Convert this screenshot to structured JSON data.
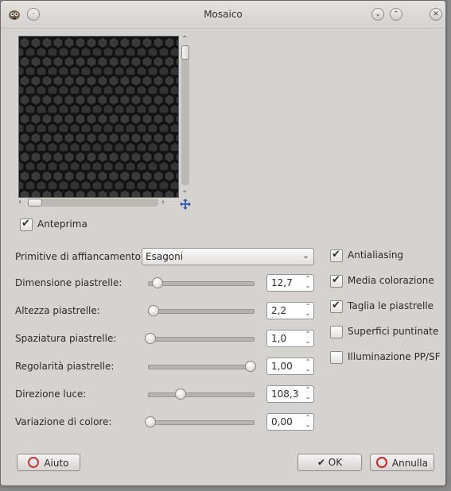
{
  "window": {
    "title": "Mosaico"
  },
  "preview": {
    "checkbox_label": "Anteprima",
    "checked": true
  },
  "primitive": {
    "label": "Primitive di affiancamento:",
    "value": "Esagoni"
  },
  "sliders": [
    {
      "label": "Dimensione piastrelle:",
      "value": "12,7",
      "level": 0.07
    },
    {
      "label": "Altezza piastrelle:",
      "value": "2,2",
      "level": 0.03
    },
    {
      "label": "Spaziatura piastrelle:",
      "value": "1,0",
      "level": 0.0
    },
    {
      "label": "Regolarità piastrelle:",
      "value": "1,00",
      "level": 1.0
    },
    {
      "label": "Direzione luce:",
      "value": "108,3",
      "level": 0.3
    },
    {
      "label": "Variazione di colore:",
      "value": "0,00",
      "level": 0.0
    }
  ],
  "options": [
    {
      "label": "Antialiasing",
      "checked": true
    },
    {
      "label": "Media colorazione",
      "checked": true
    },
    {
      "label": "Taglia le piastrelle",
      "checked": true
    },
    {
      "label": "Superfici puntinate",
      "checked": false
    },
    {
      "label": "Illuminazione PP/SF",
      "checked": false
    }
  ],
  "buttons": {
    "help": "Aiuto",
    "ok": "OK",
    "cancel": "Annulla"
  },
  "icons": {
    "app": "gimp-icon",
    "pin": "pin-icon",
    "minimize": "minimize-icon",
    "maximize": "maximize-icon",
    "close": "close-icon",
    "move": "move-cross-icon"
  }
}
